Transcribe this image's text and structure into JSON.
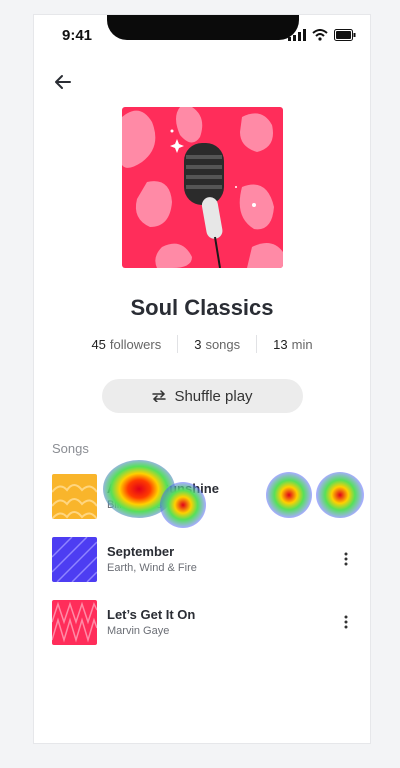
{
  "status_bar": {
    "time": "9:41"
  },
  "header": {
    "back_icon": "arrow-left-icon"
  },
  "playlist": {
    "title": "Soul Classics",
    "stats": [
      {
        "value": "45",
        "label": "followers"
      },
      {
        "value": "3",
        "label": "songs"
      },
      {
        "value": "13",
        "label": "min"
      }
    ],
    "shuffle_label": "Shuffle play",
    "cover_icon": "microphone-icon",
    "colors": {
      "cover_bg": "#ff2d5a",
      "cover_blob": "#ff8aa6"
    }
  },
  "songs_section": {
    "label": "Songs",
    "songs": [
      {
        "title": "Ain’t No Sunshine",
        "artist": "Bill Withers",
        "thumb_color": "#f9b52b"
      },
      {
        "title": "September",
        "artist": "Earth, Wind & Fire",
        "thumb_color": "#4d3df2"
      },
      {
        "title": "Let’s Get It On",
        "artist": "Marvin Gaye",
        "thumb_color": "#ff2d5a"
      }
    ]
  }
}
